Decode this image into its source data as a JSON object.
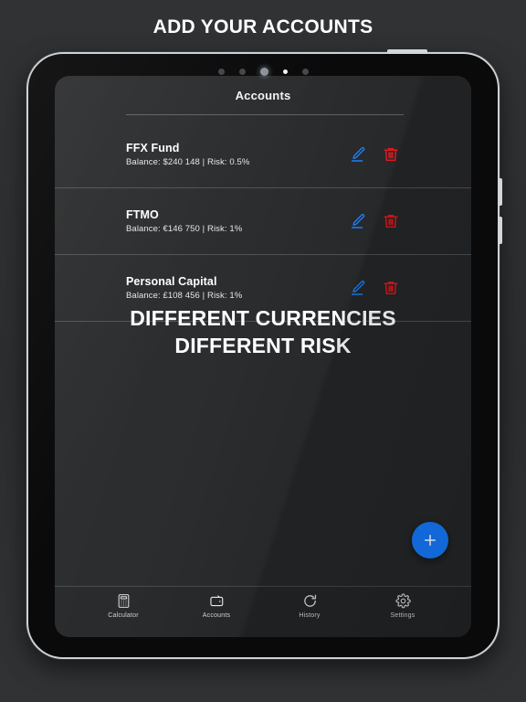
{
  "promo": {
    "headline": "ADD YOUR ACCOUNTS"
  },
  "device": {
    "carousel_dots": [
      {
        "state": "dim"
      },
      {
        "state": "dim"
      },
      {
        "state": "mid"
      },
      {
        "state": "active"
      },
      {
        "state": "dim"
      }
    ],
    "side_buttons": [
      "power-button",
      "volume-up-button",
      "volume-down-button"
    ]
  },
  "app": {
    "screen_title": "Accounts",
    "accounts": [
      {
        "name": "FFX Fund",
        "details": "Balance: $240 148 | Risk: 0.5%",
        "edit_icon": "pencil-icon",
        "delete_icon": "trash-icon"
      },
      {
        "name": "FTMO",
        "details": "Balance: €146 750 | Risk: 1%",
        "edit_icon": "pencil-icon",
        "delete_icon": "trash-icon"
      },
      {
        "name": "Personal Capital",
        "details": "Balance: £108 456 | Risk: 1%",
        "edit_icon": "pencil-icon",
        "delete_icon": "trash-icon"
      }
    ],
    "overlay_copy": {
      "line1": "DIFFERENT CURRENCIES",
      "line2": "DIFFERENT RISK"
    },
    "fab": {
      "label": "+",
      "icon": "plus-icon"
    },
    "nav": [
      {
        "label": "Calculator",
        "icon": "calculator-icon",
        "active": false
      },
      {
        "label": "Accounts",
        "icon": "wallet-icon",
        "active": true
      },
      {
        "label": "History",
        "icon": "refresh-icon",
        "active": false
      },
      {
        "label": "Settings",
        "icon": "gear-icon",
        "active": false
      }
    ]
  },
  "colors": {
    "accent_blue": "#1579fb",
    "edit_blue": "#1a7dfb",
    "delete_red": "#e8151a",
    "page_background": "#2b2d2f",
    "screen_background": "#242628",
    "text_primary": "#ffffff",
    "text_secondary": "#e4e6e8",
    "nav_label": "#cfd2d5"
  }
}
